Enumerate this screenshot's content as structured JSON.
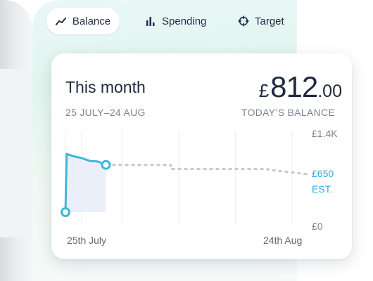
{
  "tabs": [
    {
      "label": "Balance",
      "icon": "line-chart-icon",
      "active": true
    },
    {
      "label": "Spending",
      "icon": "bar-chart-icon",
      "active": false
    },
    {
      "label": "Target",
      "icon": "crosshair-icon",
      "active": false
    }
  ],
  "card": {
    "title": "This month",
    "date_range": "25 JULY–24 AUG",
    "balance_currency": "£",
    "balance_whole": "812",
    "balance_pence": ".00",
    "balance_label": "TODAY’S BALANCE"
  },
  "chart_data": {
    "type": "line",
    "y_labels": {
      "max": "£1.4K",
      "min": "£0",
      "estimate": "£650",
      "estimate_suffix": "EST."
    },
    "x_labels": {
      "start": "25th July",
      "end": "24th Aug"
    },
    "ylim": [
      0,
      1400
    ],
    "xlim": [
      0,
      30
    ],
    "actual": [
      [
        0,
        0
      ],
      [
        0.15,
        1000
      ],
      [
        1,
        960
      ],
      [
        2,
        930
      ],
      [
        3,
        880
      ],
      [
        4,
        870
      ],
      [
        5,
        812
      ]
    ],
    "projected": [
      [
        5,
        812
      ],
      [
        13,
        812
      ],
      [
        13,
        740
      ],
      [
        25,
        740
      ],
      [
        25,
        730
      ],
      [
        30,
        650
      ]
    ],
    "colors": {
      "actual": "#3fb6dc",
      "fill": "#e7ecf8",
      "projected": "#c6c9ce",
      "grid": "#eceef1"
    }
  }
}
